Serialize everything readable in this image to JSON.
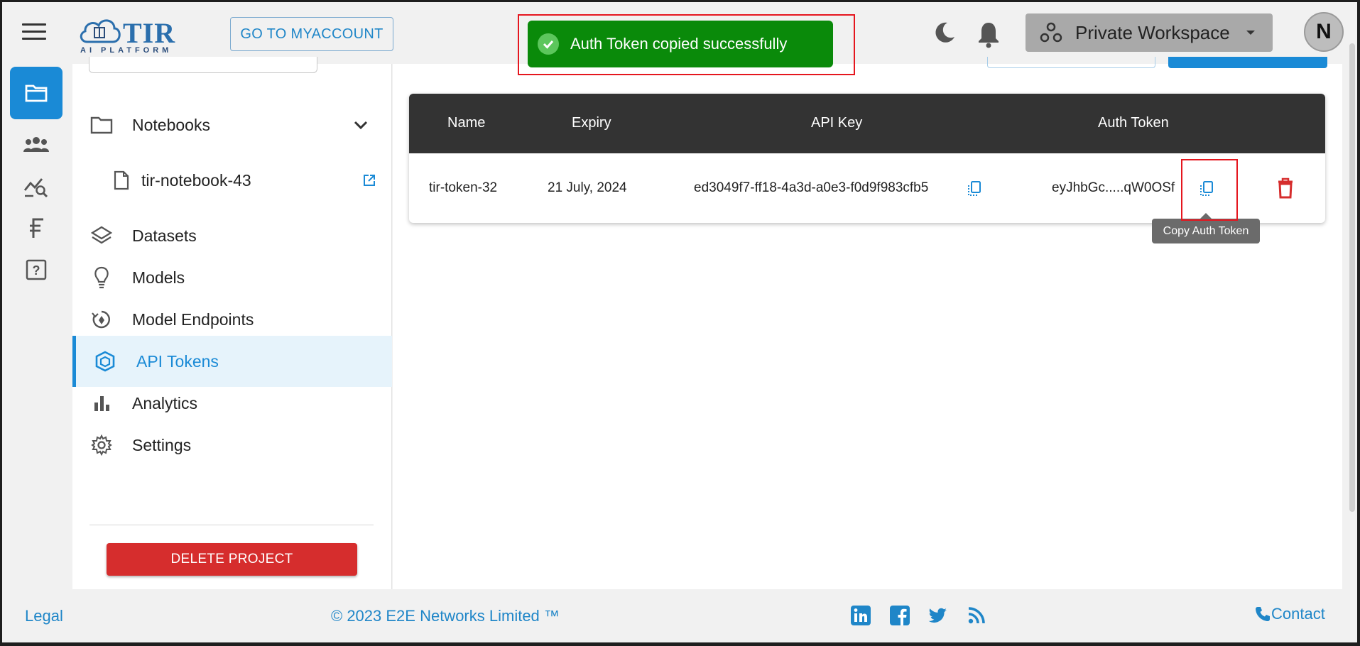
{
  "header": {
    "logo_title": "TIR",
    "logo_subtitle": "AI PLATFORM",
    "myaccount_label": "GO TO MYACCOUNT",
    "workspace_label": "Private Workspace",
    "avatar_initial": "N"
  },
  "toast": {
    "message": "Auth Token copied successfully",
    "color": "#0a8a0a"
  },
  "rail": {
    "items": [
      {
        "icon": "folder-icon",
        "active": true
      },
      {
        "icon": "team-icon",
        "active": false
      },
      {
        "icon": "analytics-search-icon",
        "active": false
      },
      {
        "icon": "billing-icon",
        "active": false
      },
      {
        "icon": "help-icon",
        "active": false
      }
    ]
  },
  "sidebar": {
    "items": [
      {
        "label": "Notebooks",
        "icon": "folder-outline-icon"
      },
      {
        "label": "tir-notebook-43",
        "icon": "file-icon"
      },
      {
        "label": "Datasets",
        "icon": "layers-icon"
      },
      {
        "label": "Models",
        "icon": "lightbulb-icon"
      },
      {
        "label": "Model Endpoints",
        "icon": "endpoint-icon"
      },
      {
        "label": "API Tokens",
        "icon": "cube-icon",
        "active": true
      },
      {
        "label": "Analytics",
        "icon": "bar-chart-icon"
      },
      {
        "label": "Settings",
        "icon": "gear-icon"
      }
    ],
    "delete_project_label": "DELETE PROJECT"
  },
  "table": {
    "headers": [
      "Name",
      "Expiry",
      "API Key",
      "Auth Token"
    ],
    "rows": [
      {
        "name": "tir-token-32",
        "expiry": "21 July, 2024",
        "api_key": "ed3049f7-ff18-4a3d-a0e3-f0d9f983cfb5",
        "auth_token": "eyJhbGc.....qW0OSf"
      }
    ],
    "tooltip": "Copy Auth Token"
  },
  "footer": {
    "legal": "Legal",
    "copyright": "© 2023 E2E Networks Limited ™",
    "contact": "Contact"
  },
  "colors": {
    "accent": "#1a8ad6",
    "danger": "#d62d2d",
    "header_bg": "#333333"
  }
}
